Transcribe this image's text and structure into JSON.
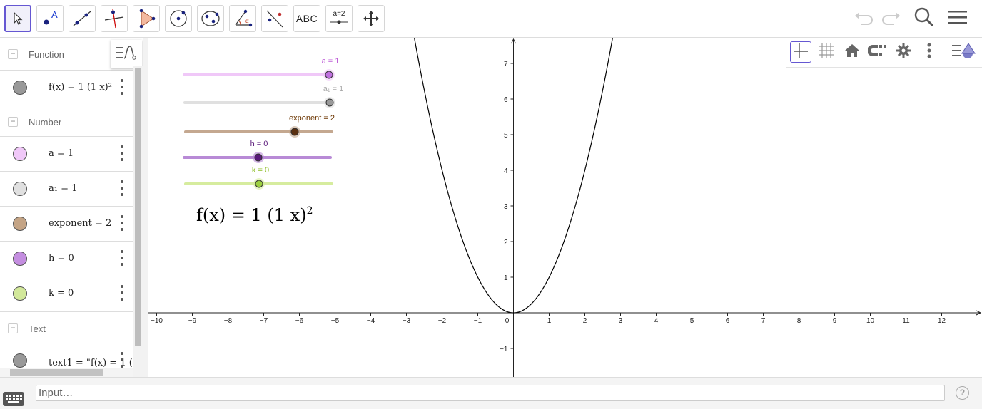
{
  "toolbar": {
    "tools": [
      {
        "name": "move-tool",
        "icon": "arrow-pointer-icon"
      },
      {
        "name": "point-tool",
        "icon": "point-icon"
      },
      {
        "name": "line-tool",
        "icon": "line-icon"
      },
      {
        "name": "perpendicular-line-tool",
        "icon": "perpendicular-line-icon"
      },
      {
        "name": "polygon-tool",
        "icon": "polygon-icon"
      },
      {
        "name": "circle-tool",
        "icon": "circle-icon"
      },
      {
        "name": "ellipse-tool",
        "icon": "ellipse-icon"
      },
      {
        "name": "angle-tool",
        "icon": "angle-icon"
      },
      {
        "name": "reflect-tool",
        "icon": "reflect-icon"
      },
      {
        "name": "text-tool",
        "icon": "text-icon",
        "label": "ABC"
      },
      {
        "name": "slider-tool",
        "icon": "slider-icon",
        "label": "a=2"
      },
      {
        "name": "move-graphics-tool",
        "icon": "move-graphics-icon"
      }
    ],
    "selected": "move-tool",
    "right_icons": [
      "undo-icon",
      "redo-icon",
      "search-icon",
      "menu-icon"
    ]
  },
  "algebra": {
    "categories": [
      {
        "label": "Function",
        "items": [
          {
            "expr": "f(x) = 1 (1 x)²",
            "color": "#999999"
          }
        ]
      },
      {
        "label": "Number",
        "items": [
          {
            "expr": "a = 1",
            "color": "#e8b8f2"
          },
          {
            "expr": "a₁ = 1",
            "color": "#d9d9d9"
          },
          {
            "expr": "exponent = 2",
            "color": "#c4a485"
          },
          {
            "expr": "h = 0",
            "color": "#c48ee0"
          },
          {
            "expr": "k = 0",
            "color": "#d2e89a"
          }
        ]
      },
      {
        "label": "Text",
        "items": [
          {
            "expr": "text1 = \"f(x) = 1 (",
            "color": "#999999"
          }
        ]
      }
    ]
  },
  "graphics": {
    "style_bar_icons": [
      "axes-icon",
      "grid-icon",
      "home-icon",
      "magnet-icon",
      "gear-icon",
      "more-icon",
      "graphics-view-icon"
    ],
    "sliders": [
      {
        "name": "a",
        "label": "a = 1",
        "value": 1,
        "color": "#c070e0",
        "track": "#f0c8f8",
        "label_color": "#c060d8"
      },
      {
        "name": "a1",
        "label": "a₁ = 1",
        "value": 1,
        "color": "#999999",
        "track": "#e0e0e0",
        "label_color": "#aaaaaa"
      },
      {
        "name": "exponent",
        "label": "exponent = 2",
        "value": 2,
        "color": "#5a3010",
        "track": "#c4a890",
        "label_color": "#6b3500"
      },
      {
        "name": "h",
        "label": "h = 0",
        "value": 0,
        "color": "#5a1a7a",
        "track": "#b88ad6",
        "label_color": "#5a1a7a"
      },
      {
        "name": "k",
        "label": "k = 0",
        "value": 0,
        "color": "#9cd040",
        "track": "#d6ec9e",
        "label_color": "#8fbf2a"
      }
    ],
    "function_text": {
      "base": "f(x)  =  1 (1 x)",
      "exponent": "2"
    }
  },
  "chart_data": {
    "type": "line",
    "title": "",
    "xlabel": "",
    "ylabel": "",
    "xlim": [
      -10.2,
      13.1
    ],
    "ylim": [
      -1.8,
      7.8
    ],
    "x_ticks": [
      -10,
      -9,
      -8,
      -7,
      -6,
      -5,
      -4,
      -3,
      -2,
      -1,
      0,
      1,
      2,
      3,
      4,
      5,
      6,
      7,
      8,
      9,
      10,
      11,
      12
    ],
    "y_ticks": [
      -1,
      1,
      2,
      3,
      4,
      5,
      6,
      7
    ],
    "grid": false,
    "series": [
      {
        "function": "1*(1*x)^2",
        "x": [
          -2.8,
          -2,
          -1,
          0,
          1,
          2,
          2.8
        ],
        "y": [
          7.84,
          4,
          1,
          0,
          1,
          4,
          7.84
        ]
      }
    ]
  },
  "input": {
    "placeholder": "Input…"
  },
  "help_label": "?"
}
